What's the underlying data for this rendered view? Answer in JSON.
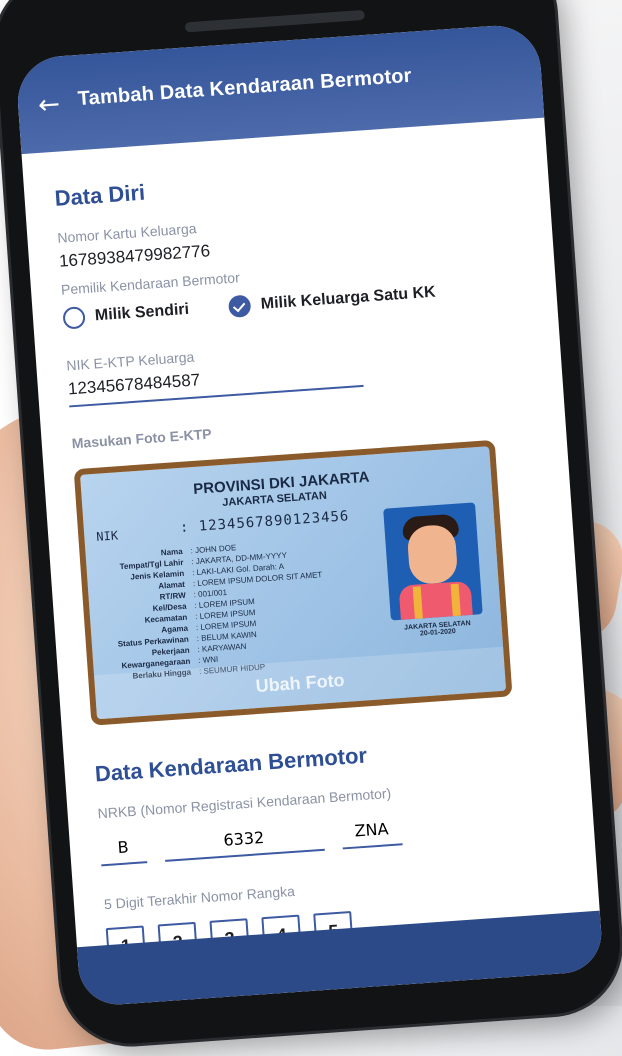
{
  "colors": {
    "primary": "#35569a",
    "accent": "#3d5aa2",
    "label": "#8b92a4",
    "text": "#1d1f25"
  },
  "app": {
    "title": "Tambah Data Kendaraan Bermotor",
    "back_icon": "arrow-left-icon"
  },
  "data_diri": {
    "section_title": "Data Diri",
    "kk_label": "Nomor Kartu Keluarga",
    "kk_value": "1678938479982776",
    "owner_label": "Pemilik Kendaraan Bermotor",
    "owner_options": [
      {
        "label": "Milik Sendiri",
        "selected": false
      },
      {
        "label": "Milik Keluarga Satu KK",
        "selected": true
      }
    ],
    "nik_label": "NIK E-KTP Keluarga",
    "nik_value": "12345678484587",
    "photo_label": "Masukan Foto E-KTP",
    "change_photo": "Ubah Foto"
  },
  "ktp": {
    "prov": "PROVINSI DKI JAKARTA",
    "city": "JAKARTA SELATAN",
    "nik_key": "NIK",
    "nik_val": ": 1234567890123456",
    "fields": [
      {
        "k": "Nama",
        "v": ": JOHN DOE"
      },
      {
        "k": "Tempat/Tgl Lahir",
        "v": ": JAKARTA, DD-MM-YYYY"
      },
      {
        "k": "Jenis Kelamin",
        "v": ": LAKI-LAKI    Gol. Darah: A"
      },
      {
        "k": "Alamat",
        "v": ": LOREM IPSUM DOLOR SIT AMET"
      },
      {
        "k": "RT/RW",
        "v": ": 001/001"
      },
      {
        "k": "Kel/Desa",
        "v": ": LOREM IPSUM"
      },
      {
        "k": "Kecamatan",
        "v": ": LOREM IPSUM"
      },
      {
        "k": "Agama",
        "v": ": LOREM IPSUM"
      },
      {
        "k": "Status Perkawinan",
        "v": ": BELUM KAWIN"
      },
      {
        "k": "Pekerjaan",
        "v": ": KARYAWAN"
      },
      {
        "k": "Kewarganegaraan",
        "v": ": WNI"
      },
      {
        "k": "Berlaku Hingga",
        "v": ": SEUMUR HIDUP"
      }
    ],
    "sign_city": "JAKARTA SELATAN",
    "sign_date": "20-01-2020"
  },
  "kendaraan": {
    "section_title": "Data Kendaraan Bermotor",
    "nrkb_label": "NRKB (Nomor Registrasi Kendaraan Bermotor)",
    "nrkb_prefix": "B",
    "nrkb_number": "6332",
    "nrkb_suffix": "ZNA",
    "rangka_label": "5 Digit Terakhir Nomor Rangka",
    "digits": [
      "1",
      "2",
      "3",
      "4",
      "5"
    ]
  }
}
